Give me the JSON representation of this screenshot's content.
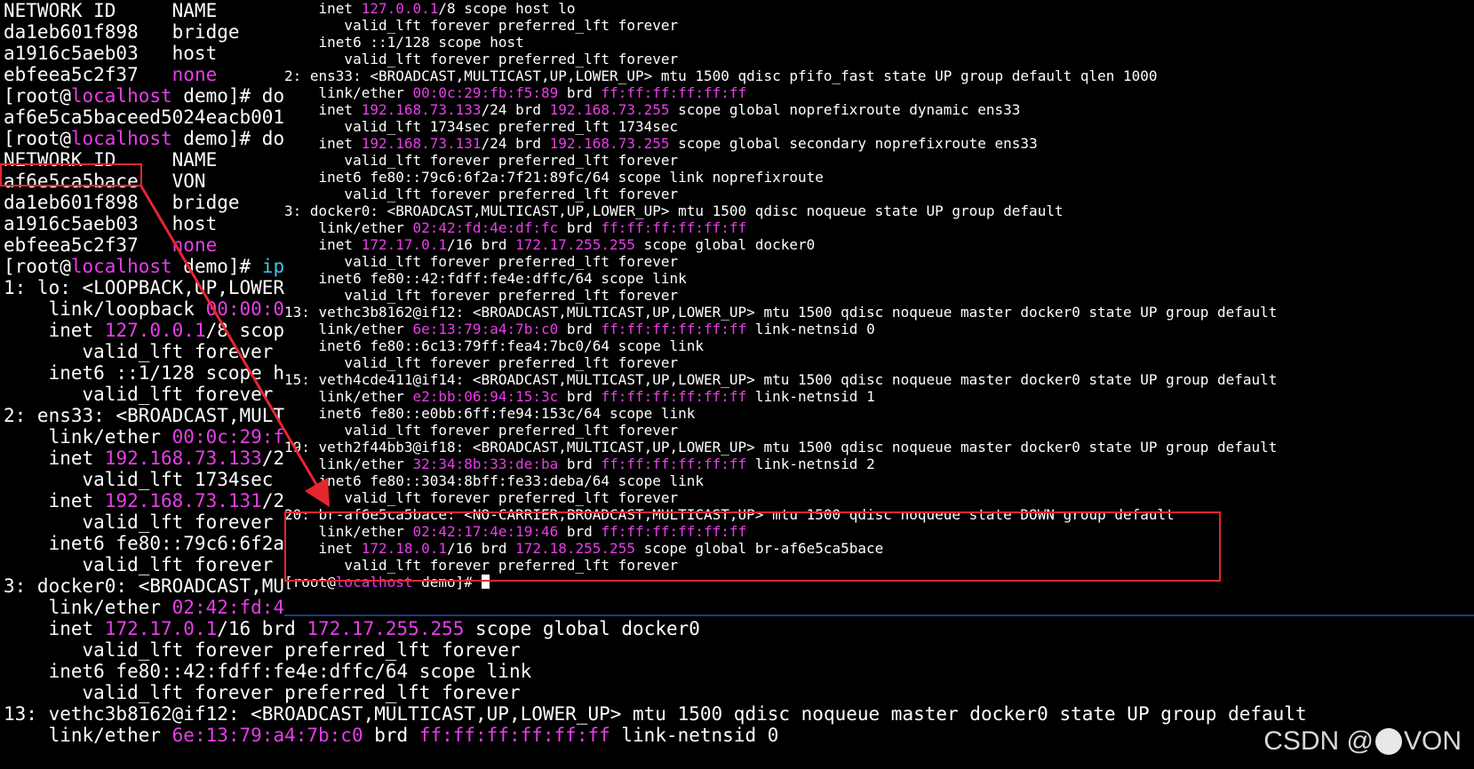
{
  "colors": {
    "text": "#ffffff",
    "magenta": "#e83ee8",
    "cyan": "#3ec6e8",
    "highlight": "#e6262e",
    "background": "#000000"
  },
  "background_terminal": {
    "lines": [
      [
        {
          "t": "NETWORK ID     NAME"
        }
      ],
      [
        {
          "t": "da1eb601f898   bridge"
        }
      ],
      [
        {
          "t": "a1916c5aeb03   host"
        }
      ],
      [
        {
          "t": "ebfeea5c2f37   "
        },
        {
          "t": "none",
          "c": "m"
        }
      ],
      [
        {
          "t": "[root@"
        },
        {
          "t": "localhost",
          "c": "m"
        },
        {
          "t": " demo]# doc"
        }
      ],
      [
        {
          "t": "af6e5ca5baceed5024eacb0015"
        }
      ],
      [
        {
          "t": "[root@"
        },
        {
          "t": "localhost",
          "c": "m"
        },
        {
          "t": " demo]# doc"
        }
      ],
      [
        {
          "t": "NETWORK ID     NAME"
        }
      ],
      [
        {
          "t": "af6e5ca5bace   VON"
        }
      ],
      [
        {
          "t": "da1eb601f898   bridge"
        }
      ],
      [
        {
          "t": "a1916c5aeb03   host"
        }
      ],
      [
        {
          "t": "ebfeea5c2f37   "
        },
        {
          "t": "none",
          "c": "m"
        }
      ],
      [
        {
          "t": "[root@"
        },
        {
          "t": "localhost",
          "c": "m"
        },
        {
          "t": " demo]# "
        },
        {
          "t": "ip",
          "c": "c"
        }
      ],
      [
        {
          "t": "1: lo: <LOOPBACK,UP,LOWER_"
        }
      ],
      [
        {
          "t": "    link/loopback "
        },
        {
          "t": "00:00:00",
          "c": "m"
        }
      ],
      [
        {
          "t": "    inet "
        },
        {
          "t": "127.0.0.1",
          "c": "m"
        },
        {
          "t": "/8 scope"
        }
      ],
      [
        {
          "t": "       valid_lft forever p"
        }
      ],
      [
        {
          "t": "    inet6 ::1/128 scope ho"
        }
      ],
      [
        {
          "t": "       valid_lft forever p"
        }
      ],
      [
        {
          "t": "2: ens33: <BROADCAST,MULTI"
        }
      ],
      [
        {
          "t": "    link/ether "
        },
        {
          "t": "00:0c:29:fb",
          "c": "m"
        }
      ],
      [
        {
          "t": "    inet "
        },
        {
          "t": "192.168.73.133",
          "c": "m"
        },
        {
          "t": "/24"
        }
      ],
      [
        {
          "t": "       valid_lft 1734sec p"
        }
      ],
      [
        {
          "t": "    inet "
        },
        {
          "t": "192.168.73.131",
          "c": "m"
        },
        {
          "t": "/24"
        }
      ],
      [
        {
          "t": "       valid_lft forever p"
        }
      ],
      [
        {
          "t": "    inet6 fe80::79c6:6f2a"
        }
      ],
      [
        {
          "t": "       valid_lft forever p"
        }
      ],
      [
        {
          "t": "3: docker0: <BROADCAST,MUL"
        }
      ],
      [
        {
          "t": "    link/ether "
        },
        {
          "t": "02:42:fd:4e",
          "c": "m"
        }
      ],
      [
        {
          "t": "    inet "
        },
        {
          "t": "172.17.0.1",
          "c": "m"
        },
        {
          "t": "/16 brd "
        },
        {
          "t": "172.17.255.255",
          "c": "m"
        },
        {
          "t": " scope global docker0"
        }
      ],
      [
        {
          "t": "       valid_lft forever preferred_lft forever"
        }
      ],
      [
        {
          "t": "    inet6 fe80::42:fdff:fe4e:dffc/64 scope link"
        }
      ],
      [
        {
          "t": "       valid_lft forever preferred_lft forever"
        }
      ],
      [
        {
          "t": "13: vethc3b8162@if12: <BROADCAST,MULTICAST,UP,LOWER_UP> mtu 1500 qdisc noqueue master docker0 state UP group default"
        }
      ],
      [
        {
          "t": "    link/ether "
        },
        {
          "t": "6e:13:79:a4:7b:c0",
          "c": "m"
        },
        {
          "t": " brd "
        },
        {
          "t": "ff:ff:ff:ff:ff:ff",
          "c": "m"
        },
        {
          "t": " link-netnsid 0"
        }
      ]
    ]
  },
  "foreground_terminal": {
    "lines": [
      [
        {
          "t": "    inet "
        },
        {
          "t": "127.0.0.1",
          "c": "m"
        },
        {
          "t": "/8 scope host lo"
        }
      ],
      [
        {
          "t": "       valid_lft forever preferred_lft forever"
        }
      ],
      [
        {
          "t": "    inet6 ::1/128 scope host"
        }
      ],
      [
        {
          "t": "       valid_lft forever preferred_lft forever"
        }
      ],
      [
        {
          "t": "2: ens33: <BROADCAST,MULTICAST,UP,LOWER_UP> mtu 1500 qdisc pfifo_fast state UP group default qlen 1000"
        }
      ],
      [
        {
          "t": "    link/ether "
        },
        {
          "t": "00:0c:29:fb:f5:89",
          "c": "m"
        },
        {
          "t": " brd "
        },
        {
          "t": "ff:ff:ff:ff:ff:ff",
          "c": "m"
        }
      ],
      [
        {
          "t": "    inet "
        },
        {
          "t": "192.168.73.133",
          "c": "m"
        },
        {
          "t": "/24 brd "
        },
        {
          "t": "192.168.73.255",
          "c": "m"
        },
        {
          "t": " scope global noprefixroute dynamic ens33"
        }
      ],
      [
        {
          "t": "       valid_lft 1734sec preferred_lft 1734sec"
        }
      ],
      [
        {
          "t": "    inet "
        },
        {
          "t": "192.168.73.131",
          "c": "m"
        },
        {
          "t": "/24 brd "
        },
        {
          "t": "192.168.73.255",
          "c": "m"
        },
        {
          "t": " scope global secondary noprefixroute ens33"
        }
      ],
      [
        {
          "t": "       valid_lft forever preferred_lft forever"
        }
      ],
      [
        {
          "t": "    inet6 fe80::79c6:6f2a:7f21:89fc/64 scope link noprefixroute"
        }
      ],
      [
        {
          "t": "       valid_lft forever preferred_lft forever"
        }
      ],
      [
        {
          "t": "3: docker0: <BROADCAST,MULTICAST,UP,LOWER_UP> mtu 1500 qdisc noqueue state UP group default"
        }
      ],
      [
        {
          "t": "    link/ether "
        },
        {
          "t": "02:42:fd:4e:df:fc",
          "c": "m"
        },
        {
          "t": " brd "
        },
        {
          "t": "ff:ff:ff:ff:ff:ff",
          "c": "m"
        }
      ],
      [
        {
          "t": "    inet "
        },
        {
          "t": "172.17.0.1",
          "c": "m"
        },
        {
          "t": "/16 brd "
        },
        {
          "t": "172.17.255.255",
          "c": "m"
        },
        {
          "t": " scope global docker0"
        }
      ],
      [
        {
          "t": "       valid_lft forever preferred_lft forever"
        }
      ],
      [
        {
          "t": "    inet6 fe80::42:fdff:fe4e:dffc/64 scope link"
        }
      ],
      [
        {
          "t": "       valid_lft forever preferred_lft forever"
        }
      ],
      [
        {
          "t": "13: vethc3b8162@if12: <BROADCAST,MULTICAST,UP,LOWER_UP> mtu 1500 qdisc noqueue master docker0 state UP group default"
        }
      ],
      [
        {
          "t": "    link/ether "
        },
        {
          "t": "6e:13:79:a4:7b:c0",
          "c": "m"
        },
        {
          "t": " brd "
        },
        {
          "t": "ff:ff:ff:ff:ff:ff",
          "c": "m"
        },
        {
          "t": " link-netnsid 0"
        }
      ],
      [
        {
          "t": "    inet6 fe80::6c13:79ff:fea4:7bc0/64 scope link"
        }
      ],
      [
        {
          "t": "       valid_lft forever preferred_lft forever"
        }
      ],
      [
        {
          "t": "15: veth4cde411@if14: <BROADCAST,MULTICAST,UP,LOWER_UP> mtu 1500 qdisc noqueue master docker0 state UP group default"
        }
      ],
      [
        {
          "t": "    link/ether "
        },
        {
          "t": "e2:bb:06:94:15:3c",
          "c": "m"
        },
        {
          "t": " brd "
        },
        {
          "t": "ff:ff:ff:ff:ff:ff",
          "c": "m"
        },
        {
          "t": " link-netnsid 1"
        }
      ],
      [
        {
          "t": "    inet6 fe80::e0bb:6ff:fe94:153c/64 scope link"
        }
      ],
      [
        {
          "t": "       valid_lft forever preferred_lft forever"
        }
      ],
      [
        {
          "t": "19: veth2f44bb3@if18: <BROADCAST,MULTICAST,UP,LOWER_UP> mtu 1500 qdisc noqueue master docker0 state UP group default"
        }
      ],
      [
        {
          "t": "    link/ether "
        },
        {
          "t": "32:34:8b:33:de:ba",
          "c": "m"
        },
        {
          "t": " brd "
        },
        {
          "t": "ff:ff:ff:ff:ff:ff",
          "c": "m"
        },
        {
          "t": " link-netnsid 2"
        }
      ],
      [
        {
          "t": "    inet6 fe80::3034:8bff:fe33:deba/64 scope link"
        }
      ],
      [
        {
          "t": "       valid_lft forever preferred_lft forever"
        }
      ],
      [
        {
          "t": "20: br-af6e5ca5bace: <NO-CARRIER,BROADCAST,MULTICAST,UP> mtu 1500 qdisc noqueue state DOWN group default"
        }
      ],
      [
        {
          "t": "    link/ether "
        },
        {
          "t": "02:42:17:4e:19:46",
          "c": "m"
        },
        {
          "t": " brd "
        },
        {
          "t": "ff:ff:ff:ff:ff:ff",
          "c": "m"
        }
      ],
      [
        {
          "t": "    inet "
        },
        {
          "t": "172.18.0.1",
          "c": "m"
        },
        {
          "t": "/16 brd "
        },
        {
          "t": "172.18.255.255",
          "c": "m"
        },
        {
          "t": " scope global br-af6e5ca5bace"
        }
      ],
      [
        {
          "t": "       valid_lft forever preferred_lft forever"
        }
      ],
      [
        {
          "t": "[root@"
        },
        {
          "t": "localhost",
          "c": "m"
        },
        {
          "t": " demo]# "
        }
      ]
    ],
    "cursor_line": 34
  },
  "watermark": {
    "prefix": "CSDN @",
    "suffix": "VON"
  }
}
